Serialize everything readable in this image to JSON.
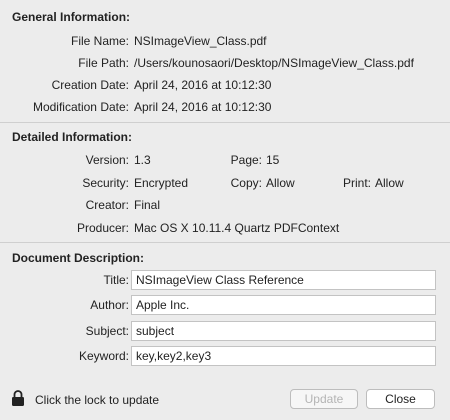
{
  "general": {
    "header": "General Information:",
    "rows": [
      {
        "label": "File Name:",
        "value": "NSImageView_Class.pdf"
      },
      {
        "label": "File Path:",
        "value": "/Users/kounosaori/Desktop/NSImageView_Class.pdf"
      },
      {
        "label": "Creation Date:",
        "value": "April 24, 2016 at 10:12:30"
      },
      {
        "label": "Modification Date:",
        "value": "April 24, 2016 at 10:12:30"
      }
    ]
  },
  "detailed": {
    "header": "Detailed Information:",
    "version_label": "Version:",
    "version": "1.3",
    "page_label": "Page:",
    "page": "15",
    "security_label": "Security:",
    "security": "Encrypted",
    "copy_label": "Copy:",
    "copy": "Allow",
    "print_label": "Print:",
    "print": "Allow",
    "creator_label": "Creator:",
    "creator": "Final",
    "producer_label": "Producer:",
    "producer": "Mac OS X 10.11.4 Quartz PDFContext"
  },
  "description": {
    "header": "Document Description:",
    "title_label": "Title:",
    "title": "NSImageView Class Reference",
    "author_label": "Author:",
    "author": "Apple Inc.",
    "subject_label": "Subject:",
    "subject": "subject",
    "keyword_label": "Keyword:",
    "keyword": "key,key2,key3"
  },
  "footer": {
    "lock_icon": "lock-icon",
    "lock_text": "Click the lock to update",
    "update_label": "Update",
    "close_label": "Close"
  }
}
